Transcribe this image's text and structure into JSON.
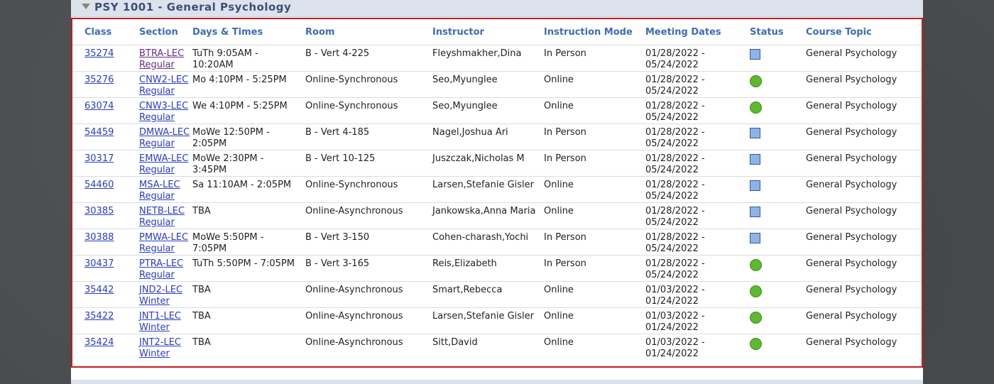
{
  "course": {
    "title": "PSY 1001 - General Psychology"
  },
  "columns": {
    "class": "Class",
    "section": "Section",
    "days_times": "Days & Times",
    "room": "Room",
    "instructor": "Instructor",
    "mode": "Instruction Mode",
    "dates": "Meeting Dates",
    "status": "Status",
    "topic": "Course Topic"
  },
  "status_legend": {
    "open": "green-circle-icon",
    "wait": "blue-square-icon"
  },
  "colors": {
    "open": "#5fb92f",
    "wait": "#8fb3e6",
    "header_text": "#3d6db5",
    "border": "#c8191e"
  },
  "rows": [
    {
      "class": "35274",
      "section": "BTRA-LEC",
      "session": "Regular",
      "times1": "TuTh 9:05AM -",
      "times2": "10:20AM",
      "room": "B - Vert 4-225",
      "instructor": "Fleyshmakher,Dina",
      "mode": "In Person",
      "dates1": "01/28/2022 -",
      "dates2": "05/24/2022",
      "status": "wait",
      "topic": "General Psychology"
    },
    {
      "class": "35276",
      "section": "CNW2-LEC",
      "session": "Regular",
      "times1": "Mo 4:10PM - 5:25PM",
      "times2": "",
      "room": "Online-Synchronous",
      "instructor": "Seo,Myunglee",
      "mode": "Online",
      "dates1": "01/28/2022 -",
      "dates2": "05/24/2022",
      "status": "open",
      "topic": "General Psychology"
    },
    {
      "class": "63074",
      "section": "CNW3-LEC",
      "session": "Regular",
      "times1": "We 4:10PM - 5:25PM",
      "times2": "",
      "room": "Online-Synchronous",
      "instructor": "Seo,Myunglee",
      "mode": "Online",
      "dates1": "01/28/2022 -",
      "dates2": "05/24/2022",
      "status": "open",
      "topic": "General Psychology"
    },
    {
      "class": "54459",
      "section": "DMWA-LEC",
      "session": "Regular",
      "times1": "MoWe 12:50PM -",
      "times2": "2:05PM",
      "room": "B - Vert 4-185",
      "instructor": "Nagel,Joshua Ari",
      "mode": "In Person",
      "dates1": "01/28/2022 -",
      "dates2": "05/24/2022",
      "status": "wait",
      "topic": "General Psychology"
    },
    {
      "class": "30317",
      "section": "EMWA-LEC",
      "session": "Regular",
      "times1": "MoWe 2:30PM -",
      "times2": "3:45PM",
      "room": "B - Vert 10-125",
      "instructor": "Juszczak,Nicholas M",
      "mode": "In Person",
      "dates1": "01/28/2022 -",
      "dates2": "05/24/2022",
      "status": "wait",
      "topic": "General Psychology"
    },
    {
      "class": "54460",
      "section": "MSA-LEC",
      "session": "Regular",
      "times1": "Sa 11:10AM - 2:05PM",
      "times2": "",
      "room": "Online-Synchronous",
      "instructor": "Larsen,Stefanie Gisler",
      "mode": "Online",
      "dates1": "01/28/2022 -",
      "dates2": "05/24/2022",
      "status": "wait",
      "topic": "General Psychology"
    },
    {
      "class": "30385",
      "section": "NETB-LEC",
      "session": "Regular",
      "times1": "TBA",
      "times2": "",
      "room": "Online-Asynchronous",
      "instructor": "Jankowska,Anna Maria",
      "mode": "Online",
      "dates1": "01/28/2022 -",
      "dates2": "05/24/2022",
      "status": "wait",
      "topic": "General Psychology"
    },
    {
      "class": "30388",
      "section": "PMWA-LEC",
      "session": "Regular",
      "times1": "MoWe 5:50PM -",
      "times2": "7:05PM",
      "room": "B - Vert 3-150",
      "instructor": "Cohen-charash,Yochi",
      "mode": "In Person",
      "dates1": "01/28/2022 -",
      "dates2": "05/24/2022",
      "status": "wait",
      "topic": "General Psychology"
    },
    {
      "class": "30437",
      "section": "PTRA-LEC",
      "session": "Regular",
      "times1": "TuTh 5:50PM - 7:05PM",
      "times2": "",
      "room": "B - Vert 3-165",
      "instructor": "Reis,Elizabeth",
      "mode": "In Person",
      "dates1": "01/28/2022 -",
      "dates2": "05/24/2022",
      "status": "open",
      "topic": "General Psychology"
    },
    {
      "class": "35442",
      "section": "JND2-LEC",
      "session": "Winter",
      "times1": "TBA",
      "times2": "",
      "room": "Online-Asynchronous",
      "instructor": "Smart,Rebecca",
      "mode": "Online",
      "dates1": "01/03/2022 -",
      "dates2": "01/24/2022",
      "status": "open",
      "topic": "General Psychology"
    },
    {
      "class": "35422",
      "section": "JNT1-LEC",
      "session": "Winter",
      "times1": "TBA",
      "times2": "",
      "room": "Online-Asynchronous",
      "instructor": "Larsen,Stefanie Gisler",
      "mode": "Online",
      "dates1": "01/03/2022 -",
      "dates2": "01/24/2022",
      "status": "open",
      "topic": "General Psychology"
    },
    {
      "class": "35424",
      "section": "JNT2-LEC",
      "session": "Winter",
      "times1": "TBA",
      "times2": "",
      "room": "Online-Asynchronous",
      "instructor": "Sitt,David",
      "mode": "Online",
      "dates1": "01/03/2022 -",
      "dates2": "01/24/2022",
      "status": "open",
      "topic": "General Psychology"
    }
  ]
}
